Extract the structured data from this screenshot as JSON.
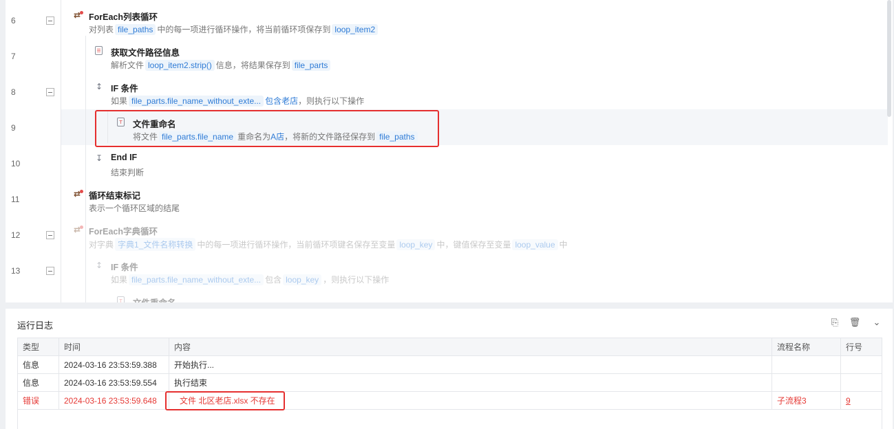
{
  "flow": {
    "rows": [
      {
        "line": "6",
        "foldable": true,
        "indent": 0,
        "icon": "loop-icon",
        "glyph": "⇄",
        "title": "ForEach列表循环",
        "desc": [
          {
            "t": "对列表"
          },
          {
            "v": "file_paths"
          },
          {
            "t": "中的每一项进行循环操作，将当前循环项保存到"
          },
          {
            "v": "loop_item2"
          }
        ]
      },
      {
        "line": "7",
        "foldable": false,
        "indent": 1,
        "icon": "file-info-icon",
        "glyph": "☰",
        "title": "获取文件路径信息",
        "desc": [
          {
            "t": "解析文件"
          },
          {
            "v": "loop_item2.strip()"
          },
          {
            "t": "信息，将结果保存到"
          },
          {
            "v": "file_parts"
          }
        ]
      },
      {
        "line": "8",
        "foldable": true,
        "indent": 1,
        "icon": "if-condition-icon",
        "glyph": "↕",
        "title": "IF 条件",
        "desc": [
          {
            "t": "如果"
          },
          {
            "v": "file_parts.file_name_without_exte..."
          },
          {
            "l": "包含老店"
          },
          {
            "t": "，则执行以下操作"
          }
        ]
      },
      {
        "line": "9",
        "foldable": false,
        "indent": 2,
        "icon": "rename-file-icon",
        "glyph": "T",
        "title": "文件重命名",
        "highlight": true,
        "desc": [
          {
            "t": "将文件"
          },
          {
            "v": "file_parts.file_name"
          },
          {
            "t": "重命名为"
          },
          {
            "l": "A店"
          },
          {
            "t": "，将新的文件路径保存到"
          },
          {
            "v": "file_paths"
          }
        ]
      },
      {
        "line": "10",
        "foldable": false,
        "indent": 1,
        "icon": "end-if-icon",
        "glyph": "↧",
        "title": "End IF",
        "desc": [
          {
            "t": "结束判断"
          }
        ]
      },
      {
        "line": "11",
        "foldable": false,
        "indent": 0,
        "icon": "loop-end-icon",
        "glyph": "⇄",
        "title": "循环结束标记",
        "desc": [
          {
            "t": "表示一个循环区域的结尾"
          }
        ]
      },
      {
        "line": "12",
        "foldable": true,
        "indent": 0,
        "icon": "dict-loop-icon",
        "glyph": "⇄",
        "title": "ForEach字典循环",
        "faded": true,
        "desc": [
          {
            "t": "对字典"
          },
          {
            "v": "字典1_文件名称转换"
          },
          {
            "t": "中的每一项进行循环操作，当前循环项键名保存至变量"
          },
          {
            "v": "loop_key"
          },
          {
            "t": "中，键值保存至变量"
          },
          {
            "v": "loop_value"
          },
          {
            "t": "中"
          }
        ]
      },
      {
        "line": "13",
        "foldable": true,
        "indent": 1,
        "icon": "if-condition-icon",
        "glyph": "↕",
        "title": "IF 条件",
        "faded": true,
        "desc": [
          {
            "t": "如果"
          },
          {
            "v": "file_parts.file_name_without_exte..."
          },
          {
            "t": "包含"
          },
          {
            "v": "loop_key"
          },
          {
            "t": "，则执行以下操作"
          }
        ]
      },
      {
        "line": "",
        "foldable": false,
        "indent": 2,
        "icon": "rename-file-icon",
        "glyph": "T",
        "title": "文件重命名",
        "faded": true,
        "desc": []
      }
    ]
  },
  "log": {
    "title": "运行日志",
    "tools": [
      "export-icon",
      "trash-icon",
      "chevron-down-icon"
    ],
    "columns": [
      "类型",
      "时间",
      "内容",
      "流程名称",
      "行号"
    ],
    "rows": [
      {
        "type": "信息",
        "time": "2024-03-16 23:53:59.388",
        "content": "开始执行...",
        "flow": "",
        "line": "",
        "error": false
      },
      {
        "type": "信息",
        "time": "2024-03-16 23:53:59.554",
        "content": "执行结束",
        "flow": "",
        "line": "",
        "error": false
      },
      {
        "type": "错误",
        "time": "2024-03-16 23:53:59.648",
        "content": "文件 北区老店.xlsx 不存在",
        "flow": "子流程3",
        "line": "9",
        "error": true
      }
    ]
  },
  "colors": {
    "accent": "#2e7bd6",
    "error": "#e53935",
    "annotation": "#e52e2e"
  }
}
